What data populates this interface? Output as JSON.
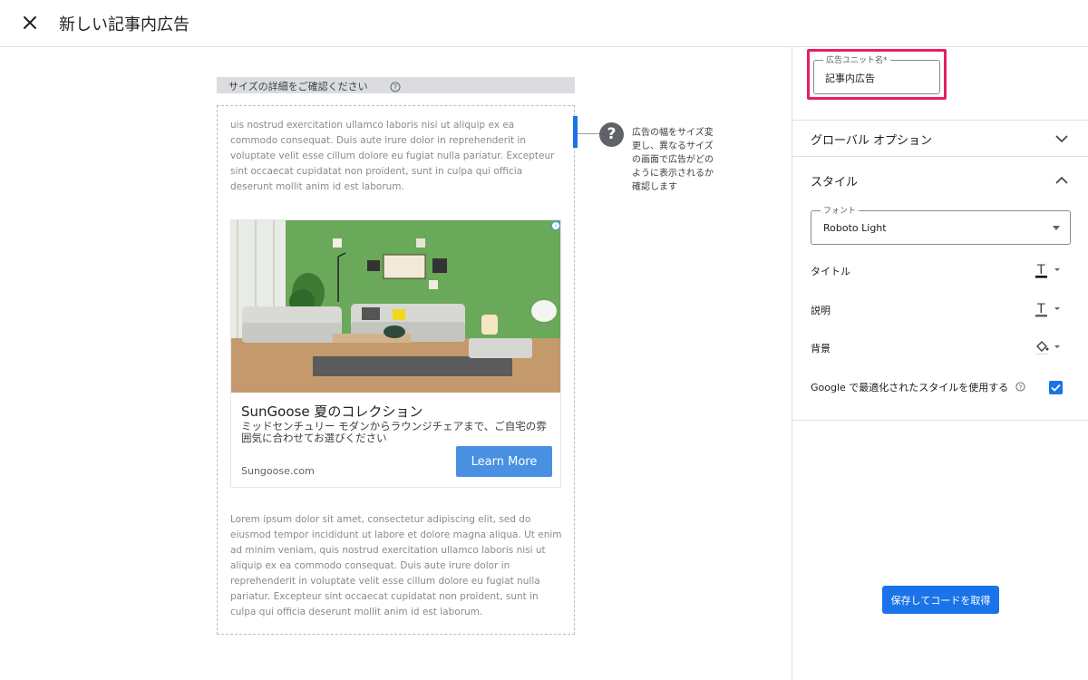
{
  "header": {
    "title": "新しい記事内広告"
  },
  "preview": {
    "size_bar_text": "サイズの詳細をご確認ください",
    "tip": "広告の幅をサイズ変更し、異なるサイズの画面で広告がどのように表示されるか確認します",
    "lorem_top": "uis nostrud exercitation ullamco laboris nisi ut aliquip ex ea commodo consequat. Duis aute irure dolor in reprehenderit in voluptate velit esse cillum dolore eu fugiat nulla pariatur. Excepteur sint occaecat cupidatat non proident, sunt in culpa qui officia deserunt mollit anim id est laborum.",
    "lorem_bottom": "Lorem ipsum dolor sit amet, consectetur adipiscing elit, sed do eiusmod tempor incididunt ut labore et dolore magna aliqua. Ut enim ad minim veniam, quis nostrud exercitation ullamco laboris nisi ut aliquip ex ea commodo consequat. Duis aute irure dolor in reprehenderit in voluptate velit esse cillum dolore eu fugiat nulla pariatur. Excepteur sint occaecat cupidatat non proident, sunt in culpa qui officia deserunt mollit anim id est laborum.",
    "ad": {
      "title": "SunGoose 夏のコレクション",
      "description": "ミッドセンチュリー モダンからラウンジチェアまで、ご自宅の雰囲気に合わせてお選びください",
      "domain": "Sungoose.com",
      "cta": "Learn More",
      "adchoices": "i"
    }
  },
  "settings": {
    "ad_unit_name_label": "広告ユニット名*",
    "ad_unit_name_value": "記事内広告",
    "global_options": "グローバル オプション",
    "style_section": "スタイル",
    "font_label": "フォント",
    "font_value": "Roboto Light",
    "title_label": "タイトル",
    "description_label": "説明",
    "background_label": "背景",
    "google_style_label": "Google で最適化されたスタイルを使用する",
    "google_style_checked": true,
    "save_button": "保存してコードを取得"
  },
  "colors": {
    "accent_blue": "#1a73e8",
    "highlight_pink": "#e91e63",
    "cta_blue": "#4a90e2"
  },
  "icons": [
    "close-icon",
    "help-icon",
    "chevron-down-icon",
    "chevron-up-icon",
    "text-color-icon",
    "fill-color-icon",
    "checkbox-check-icon",
    "adchoices-icon"
  ]
}
